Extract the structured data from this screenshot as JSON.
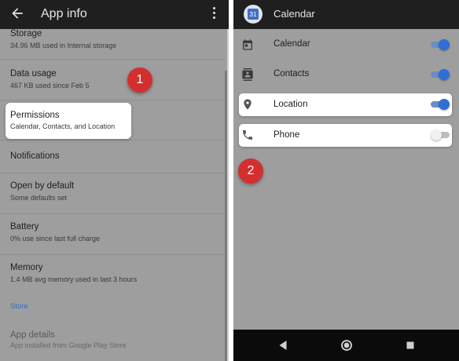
{
  "left": {
    "appbar": {
      "title": "App info",
      "back_icon": "arrow-back-icon",
      "menu_icon": "more-vert-icon"
    },
    "rows": [
      {
        "title": "Storage",
        "subtitle": "34.96 MB used in Internal storage"
      },
      {
        "title": "Data usage",
        "subtitle": "467 KB used since Feb 5"
      },
      {
        "title": "Permissions",
        "subtitle": "Calendar, Contacts, and Location"
      },
      {
        "title": "Notifications",
        "subtitle": ""
      },
      {
        "title": "Open by default",
        "subtitle": "Some defaults set"
      },
      {
        "title": "Battery",
        "subtitle": "0% use since last full charge"
      },
      {
        "title": "Memory",
        "subtitle": "1.4 MB avg memory used in last 3 hours"
      },
      {
        "title": "App details",
        "subtitle": "App installed from Google Play Store"
      }
    ],
    "store_label": "Store",
    "step_badge": "1"
  },
  "right": {
    "appbar": {
      "title": "Calendar",
      "icon_text": "31",
      "icon": "calendar-app-icon"
    },
    "permissions": [
      {
        "label": "Calendar",
        "icon": "calendar-icon",
        "enabled": true
      },
      {
        "label": "Contacts",
        "icon": "contacts-icon",
        "enabled": true
      },
      {
        "label": "Location",
        "icon": "location-pin-icon",
        "enabled": true
      },
      {
        "label": "Phone",
        "icon": "phone-icon",
        "enabled": false
      }
    ],
    "step_badge": "2",
    "navbar": {
      "back": "nav-back-icon",
      "home": "nav-home-icon",
      "recents": "nav-recents-icon"
    }
  },
  "colors": {
    "accent": "#2f6ed8",
    "badge": "#d32f2f",
    "appbar": "#1f1f1f",
    "dim_overlay": "#9e9e9e",
    "link": "#2f6dc4"
  }
}
